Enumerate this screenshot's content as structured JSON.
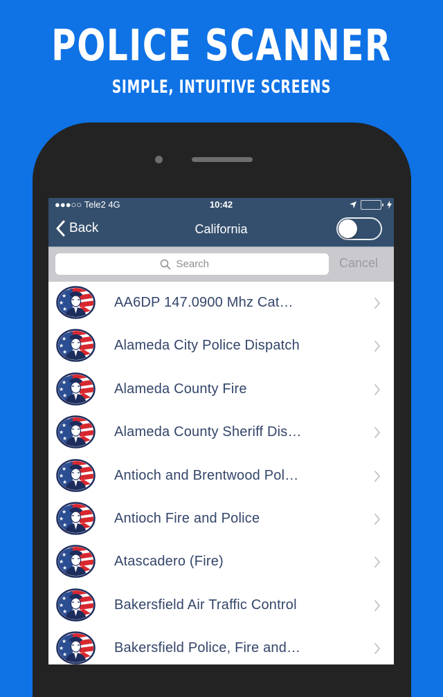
{
  "promo": {
    "headline": "POLICE SCANNER",
    "subheadline": "SIMPLE, INTUITIVE SCREENS",
    "background_color": "#0f72e5"
  },
  "status_bar": {
    "carrier": "●●●○○ Tele2   4G",
    "time": "10:42",
    "icons": [
      "location-arrow-icon",
      "battery-icon",
      "charging-bolt-icon"
    ],
    "battery_color": "#4cd964"
  },
  "nav": {
    "back_label": "Back",
    "title": "California",
    "toggle_on": false,
    "bar_color": "#344f6d"
  },
  "search": {
    "placeholder": "Search",
    "value": "",
    "cancel_label": "Cancel"
  },
  "list": {
    "items": [
      {
        "label": "AA6DP 147.0900 Mhz Cat…",
        "icon": "police-officer-flag-icon"
      },
      {
        "label": "Alameda City Police Dispatch",
        "icon": "police-officer-flag-icon"
      },
      {
        "label": "Alameda County Fire",
        "icon": "police-officer-flag-icon"
      },
      {
        "label": "Alameda County Sheriff Dis…",
        "icon": "police-officer-flag-icon"
      },
      {
        "label": "Antioch and Brentwood Pol…",
        "icon": "police-officer-flag-icon"
      },
      {
        "label": "Antioch Fire and Police",
        "icon": "police-officer-flag-icon"
      },
      {
        "label": "Atascadero (Fire)",
        "icon": "police-officer-flag-icon"
      },
      {
        "label": "Bakersfield Air Traffic Control",
        "icon": "police-officer-flag-icon"
      },
      {
        "label": "Bakersfield Police, Fire and…",
        "icon": "police-officer-flag-icon"
      }
    ]
  }
}
